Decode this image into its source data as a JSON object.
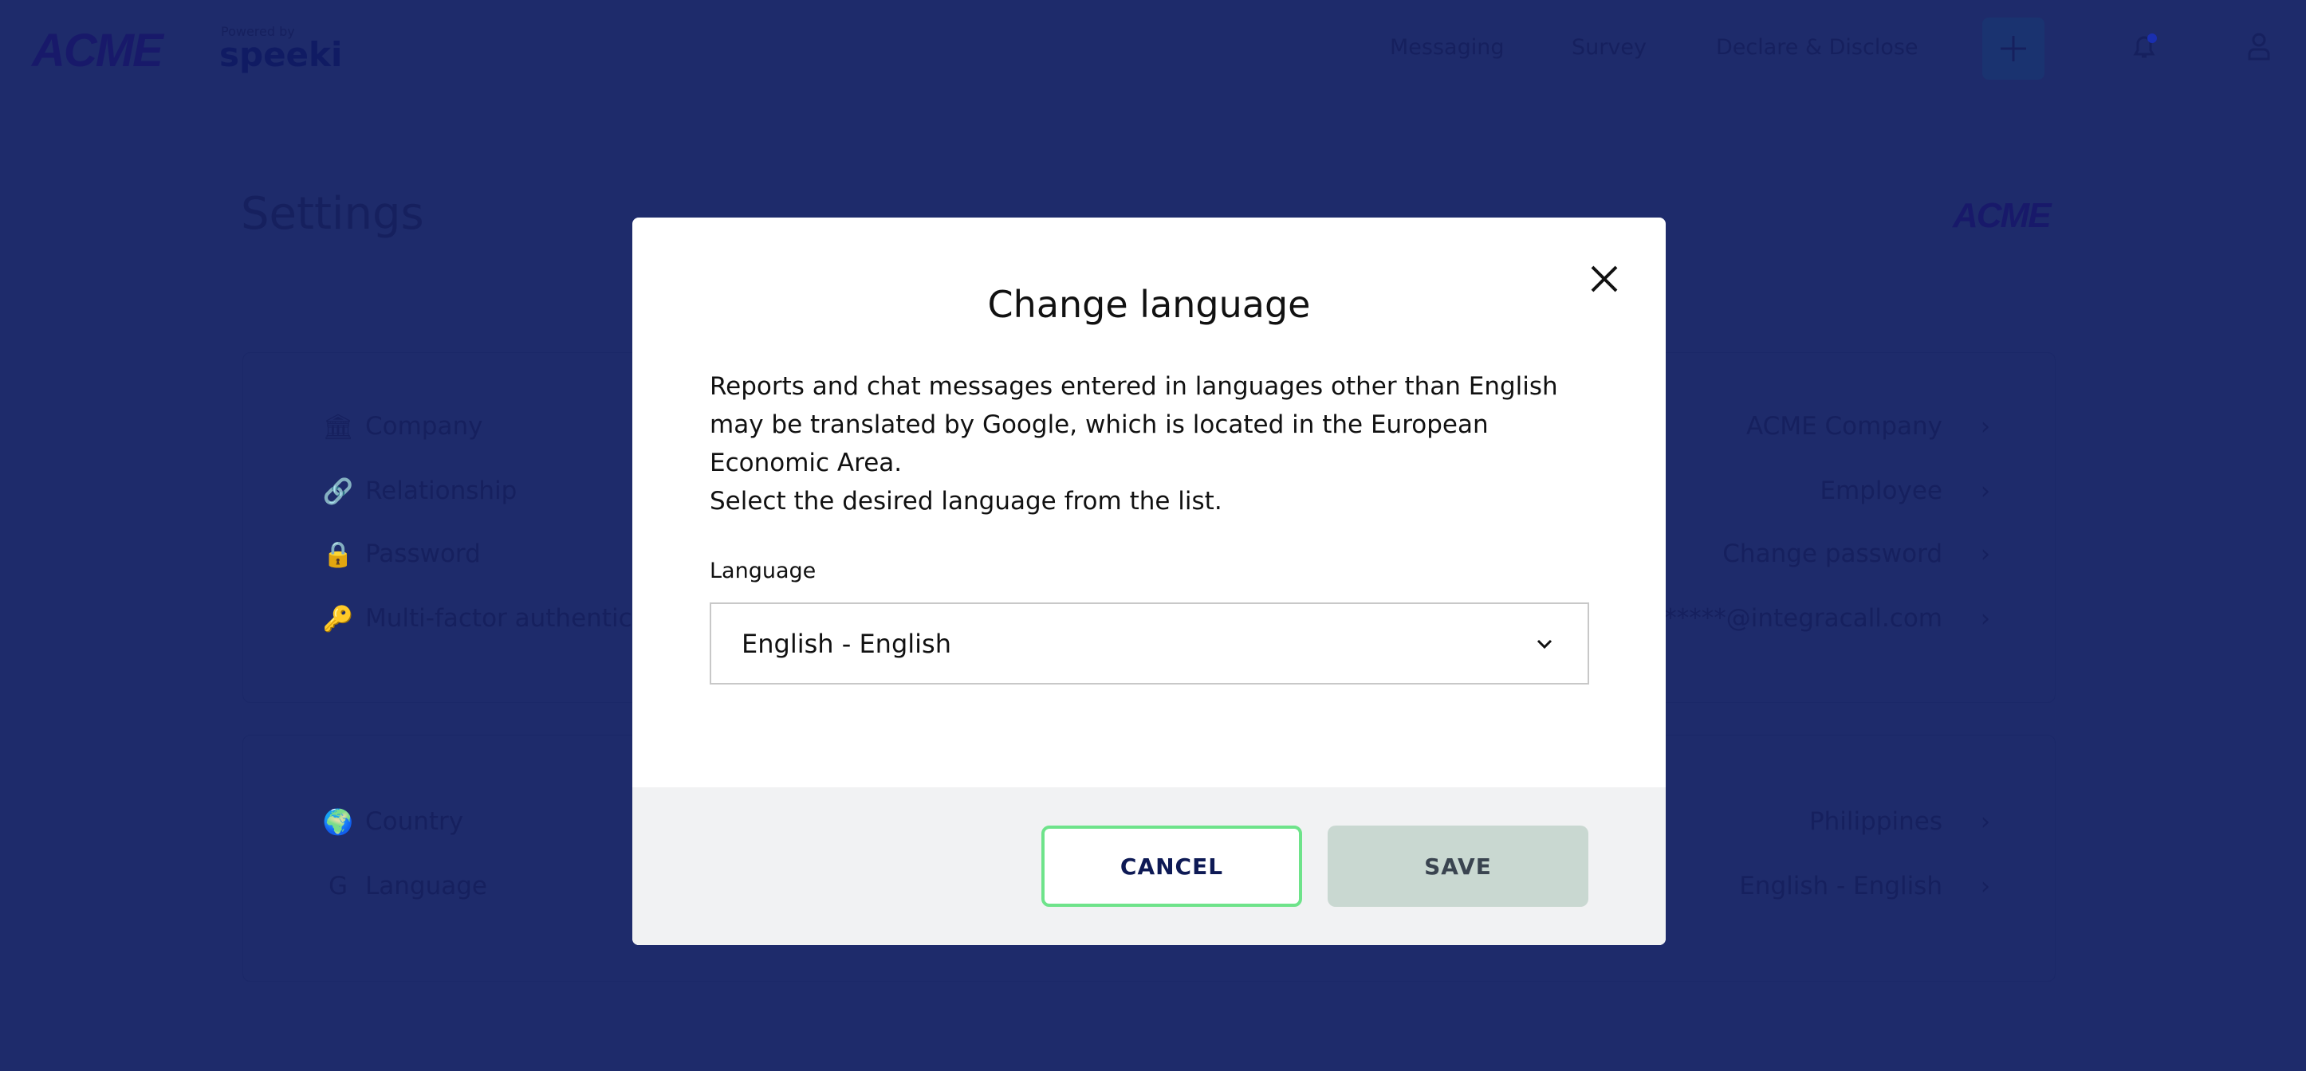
{
  "header": {
    "brand": "ACME",
    "powered_by": "Powered by",
    "speeki": "speeki",
    "nav": [
      "Messaging",
      "Survey",
      "Declare & Disclose"
    ],
    "icons": [
      "plus-icon",
      "bell-icon",
      "user-icon"
    ]
  },
  "page": {
    "title": "Settings",
    "logo": "ACME"
  },
  "account_rows": [
    {
      "label": "Company",
      "value": "ACME Company",
      "icon": "bank-icon"
    },
    {
      "label": "Relationship",
      "value": "Employee",
      "icon": "link-icon"
    },
    {
      "label": "Password",
      "value": "Change password",
      "icon": "lock-icon"
    },
    {
      "label": "Multi-factor authentication",
      "value": "******@integracall.com",
      "icon": "key-icon"
    }
  ],
  "locale_rows": [
    {
      "label": "Country",
      "value": "Philippines",
      "icon": "globe-icon"
    },
    {
      "label": "Language",
      "value": "English - English",
      "icon": "translate-icon"
    }
  ],
  "modal": {
    "title": "Change language",
    "body1": "Reports and chat messages entered in languages other than English may be translated by Google, which is located in the European Economic Area.",
    "body2": "Select the desired language from the list.",
    "field_label": "Language",
    "selected": "English - English",
    "cancel": "CANCEL",
    "save": "SAVE"
  },
  "colors": {
    "overlay": "#1e2b6b",
    "cancel_border": "#6ee38a",
    "save_bg": "#c9d8d1"
  }
}
